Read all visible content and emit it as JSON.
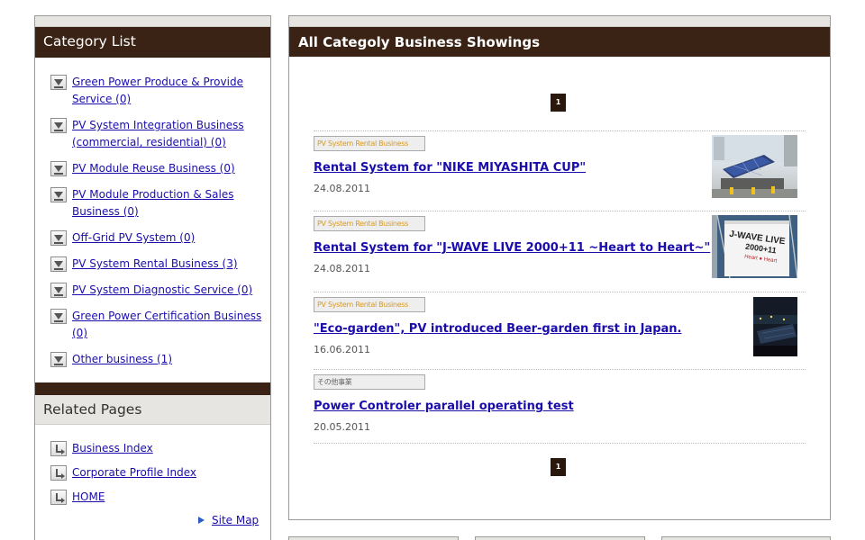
{
  "sidebar": {
    "category_title": "Category List",
    "categories": [
      {
        "label": "Green Power Produce & Provide Service (0)"
      },
      {
        "label": "PV System Integration Business (commercial, residential) (0)"
      },
      {
        "label": "PV Module Reuse Business (0)"
      },
      {
        "label": "PV Module Production & Sales Business (0)"
      },
      {
        "label": "Off-Grid PV System (0)"
      },
      {
        "label": "PV System Rental Business (3)"
      },
      {
        "label": "PV System Diagnostic Service (0)"
      },
      {
        "label": "Green Power Certification Business (0)"
      },
      {
        "label": "Other business (1)"
      }
    ],
    "related_title": "Related Pages",
    "related": [
      {
        "label": "Business Index"
      },
      {
        "label": "Corporate Profile Index"
      },
      {
        "label": "HOME"
      }
    ],
    "sitemap_label": "Site Map"
  },
  "main": {
    "title": "All Categoly Business Showings",
    "pagination": {
      "current_page": "1"
    },
    "entries": [
      {
        "tag": "PV System Rental Business",
        "title": "Rental System for \"NIKE MIYASHITA CUP\"",
        "date": "24.08.2011"
      },
      {
        "tag": "PV System Rental Business",
        "title": "Rental System for \"J-WAVE LIVE 2000+11 ~Heart to Heart~\"",
        "date": "24.08.2011",
        "thumb_text": {
          "l1": "J-WAVE LIVE",
          "l2": "2000+11",
          "l3": "Heart ● Heart"
        }
      },
      {
        "tag": "PV System Rental Business",
        "title": "\"Eco-garden\", PV introduced Beer-garden first in Japan.",
        "date": "16.06.2011"
      },
      {
        "tag": "その他事業",
        "title": "Power Controler parallel operating test",
        "date": "20.05.2011"
      }
    ]
  },
  "colors": {
    "header_brown": "#3a2314",
    "link_blue": "#1a0dab",
    "tag_orange": "#d89a20",
    "panel_gray": "#e6e5e1"
  },
  "icons": {
    "category_bullet": "download-arrow-icon",
    "related_bullet": "return-arrow-icon",
    "sitemap_bullet": "triangle-right-icon"
  }
}
